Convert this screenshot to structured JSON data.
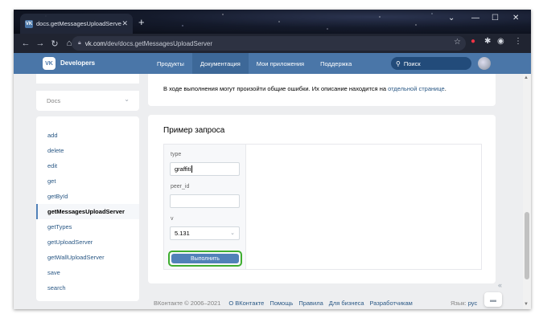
{
  "browser": {
    "tab_title": "docs.getMessagesUploadServer",
    "tab_close": "✕",
    "new_tab": "+",
    "url_host": "vk.com",
    "url_path": "/dev/docs.getMessagesUploadServer",
    "icons": [
      "back-icon",
      "forward-icon",
      "reload-icon",
      "home-icon",
      "lock-icon",
      "star-icon",
      "extension-icon",
      "puzzle-icon",
      "profile-icon",
      "menu-icon"
    ]
  },
  "header": {
    "logo": "VK",
    "brand": "Developers",
    "menu": [
      "Продукты",
      "Документация",
      "Мои приложения",
      "Поддержка"
    ],
    "active_menu": "Документация",
    "search_placeholder": "Поиск",
    "accent": "#4a76a8"
  },
  "sidebar": {
    "section": "Docs",
    "methods": [
      "add",
      "delete",
      "edit",
      "get",
      "getById",
      "getMessagesUploadServer",
      "getTypes",
      "getUploadServer",
      "getWallUploadServer",
      "save",
      "search"
    ],
    "active_method": "getMessagesUploadServer"
  },
  "errors_note": {
    "text": "В ходе выполнения могут произойти общие ошибки. Их описание находится на",
    "link": "отдельной странице",
    "end": "."
  },
  "request": {
    "title": "Пример запроса",
    "fields": [
      {
        "label": "type",
        "value": "graffiti"
      },
      {
        "label": "peer_id",
        "value": ""
      },
      {
        "label": "v",
        "value": "5.131"
      }
    ],
    "run_label": "Выполнить",
    "highlight": "#3fae30"
  },
  "footer": {
    "copyright": "ВКонтакте © 2006–2021",
    "links": [
      "О ВКонтакте",
      "Помощь",
      "Правила",
      "Для бизнеса",
      "Разработчикам"
    ],
    "lang_label": "Язык:",
    "lang_value": "рус"
  }
}
